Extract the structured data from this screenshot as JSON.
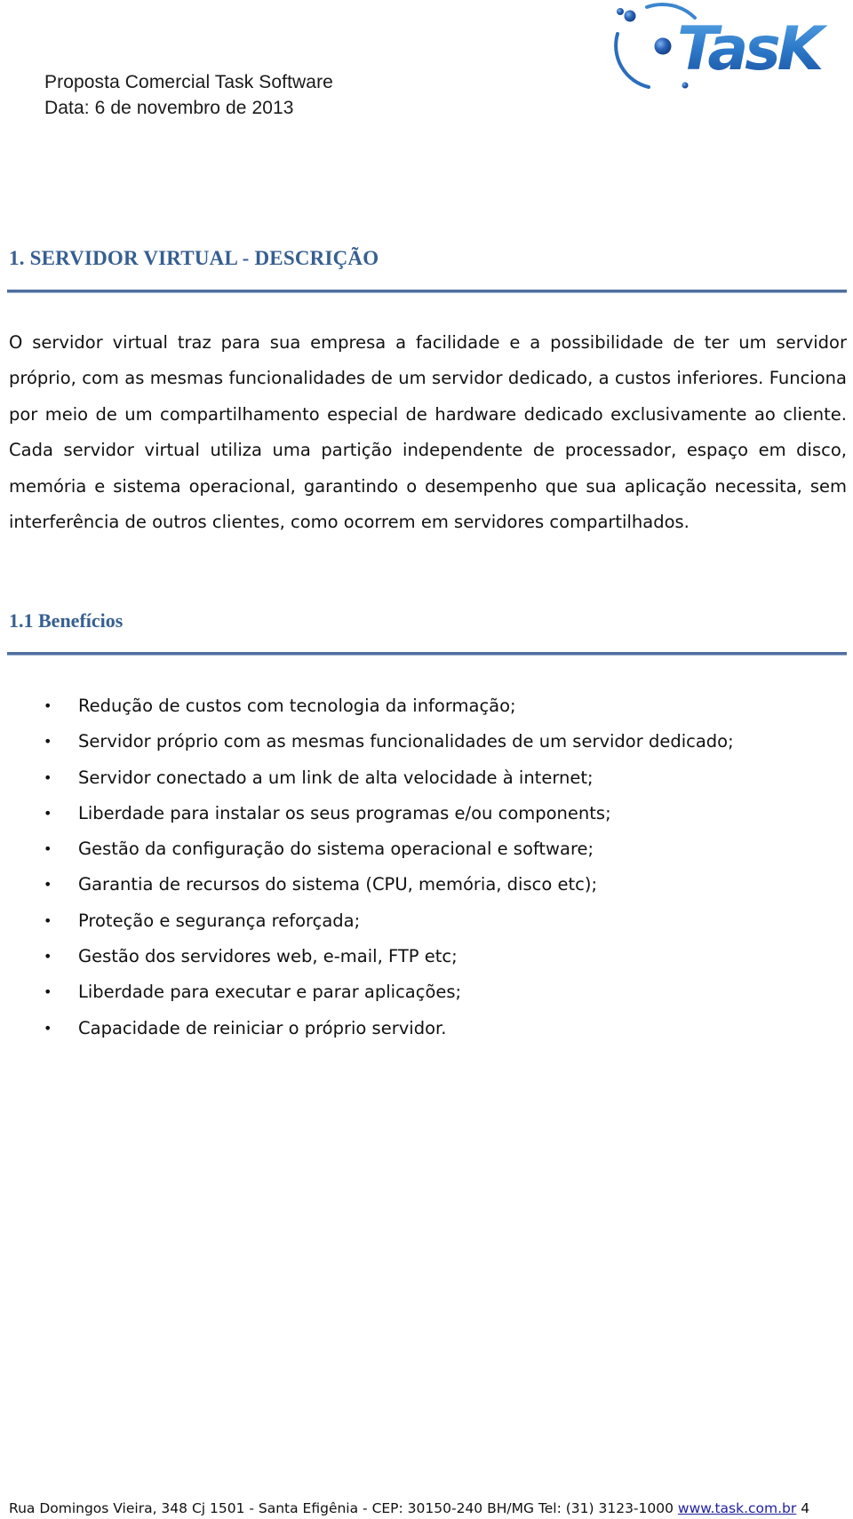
{
  "header": {
    "title": "Proposta Comercial Task Software",
    "date": "Data: 6 de novembro de 2013",
    "logo_text": "TasK",
    "logo_icon": "orbit-logo-icon"
  },
  "colors": {
    "heading": "#365f91",
    "rule": "#4f6f9f",
    "link": "#1f1fa0",
    "logo_blue": "#1e5fae",
    "logo_light": "#4f95d8"
  },
  "section1": {
    "heading": "1. SERVIDOR VIRTUAL - DESCRIÇÃO",
    "paragraph": "O servidor virtual traz para sua empresa a facilidade e a possibilidade de ter um servidor próprio, com as mesmas funcionalidades de um servidor dedicado, a custos inferiores. Funciona por meio de um compartilhamento especial de hardware dedicado exclusivamente ao cliente. Cada servidor virtual utiliza uma partição independente de processador, espaço em disco, memória e sistema operacional, garantindo o desempenho que sua aplicação necessita, sem interferência de outros clientes, como ocorrem em servidores compartilhados."
  },
  "section2": {
    "heading": "1.1 Benefícios",
    "bullet_glyph": "•",
    "items": [
      "Redução de custos com tecnologia da informação;",
      "Servidor próprio com as mesmas funcionalidades de um servidor dedicado;",
      "Servidor conectado a um link de alta velocidade à internet;",
      "Liberdade para instalar os seus programas e/ou components;",
      "Gestão da configuração do sistema operacional e software;",
      "Garantia de recursos do sistema (CPU, memória, disco etc);",
      "Proteção e segurança reforçada;",
      "Gestão dos servidores web, e-mail, FTP etc;",
      "Liberdade para executar e parar aplicações;",
      "Capacidade de reiniciar o próprio servidor."
    ]
  },
  "footer": {
    "address": "Rua Domingos Vieira, 348 Cj 1501 - Santa Efigênia - CEP: 30150-240 BH/MG Tel: (31) 3123-1000",
    "link_text": "www.task.com.br",
    "page_number": "4"
  }
}
